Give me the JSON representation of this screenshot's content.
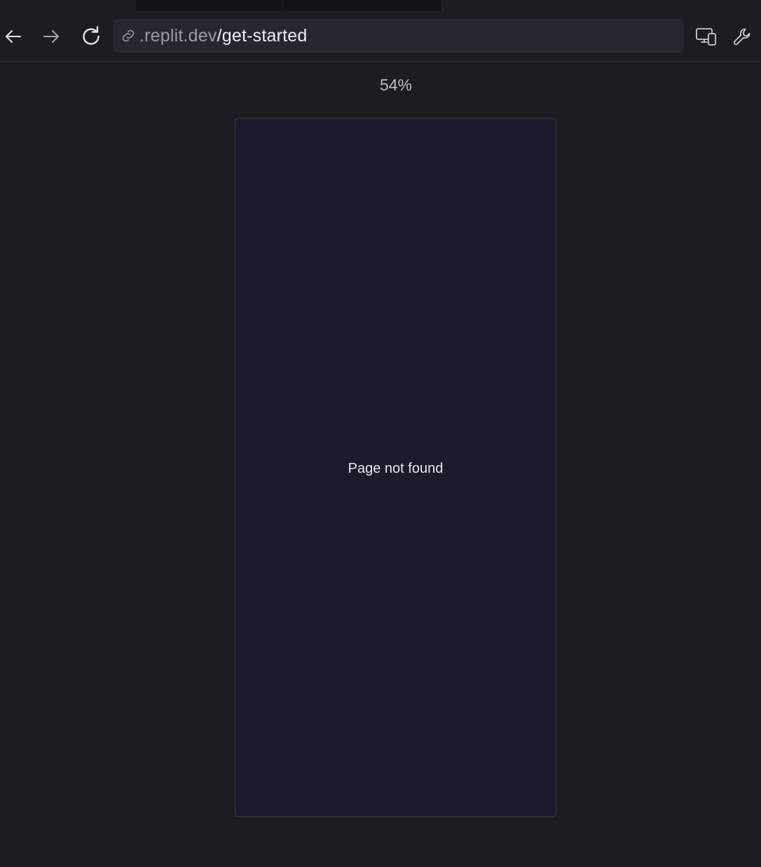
{
  "browser": {
    "url_domain": ".replit.dev",
    "url_path": "/get-started",
    "zoom_level": "54%"
  },
  "preview": {
    "message": "Page not found"
  },
  "icons": {
    "back": "arrow-left-icon",
    "forward": "arrow-right-icon",
    "reload": "reload-icon",
    "link": "link-icon",
    "devices": "devices-icon",
    "tools": "wrench-icon"
  },
  "colors": {
    "background": "#1c1d23",
    "address_bar": "#262831",
    "viewport": "#1a1b2c",
    "text_primary": "#eeeff3",
    "text_muted": "#9a9ca6"
  }
}
